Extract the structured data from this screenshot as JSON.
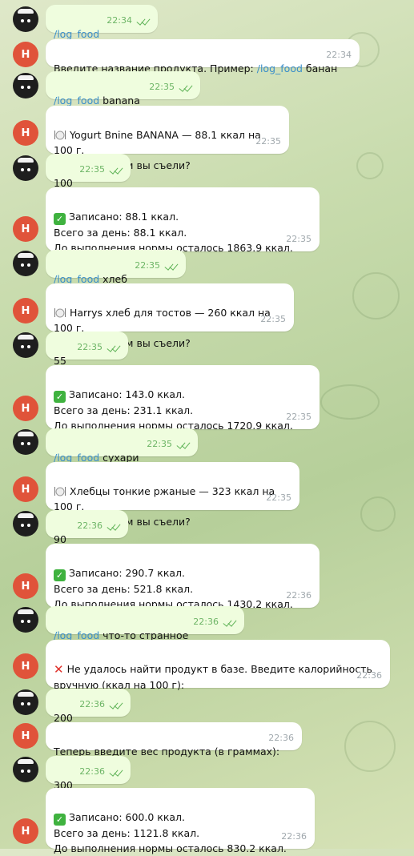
{
  "chat": {
    "user_avatar_icon": "user-avatar",
    "bot_avatar_letter": "Н",
    "messages": [
      {
        "from": "user",
        "cmd": "/log_food",
        "text": "",
        "time": "22:34"
      },
      {
        "from": "bot",
        "text": "Введите название продукта. Пример: ",
        "cmd": "/log_food",
        "text_after": " банан",
        "time": "22:34"
      },
      {
        "from": "user",
        "cmd": "/log_food",
        "text": " banana",
        "time": "22:35"
      },
      {
        "from": "bot",
        "icon": "plate-icon",
        "text": "Yogurt Bnine BANANA — 88.1 ккал на 100 г.\nСколько грамм вы съели?",
        "time": "22:35"
      },
      {
        "from": "user",
        "text": "100",
        "time": "22:35"
      },
      {
        "from": "bot",
        "icon": "check-mark-icon",
        "text": "Записано: 88.1 ккал.\nВсего за день: 88.1 ккал.\nДо выполнения нормы осталось 1863.9 ккал.",
        "time": "22:35"
      },
      {
        "from": "user",
        "cmd": "/log_food",
        "text": " хлеб",
        "time": "22:35"
      },
      {
        "from": "bot",
        "icon": "plate-icon",
        "text": "Harrys хлеб для тостов — 260 ккал на 100 г.\nСколько грамм вы съели?",
        "time": "22:35"
      },
      {
        "from": "user",
        "text": "55",
        "time": "22:35"
      },
      {
        "from": "bot",
        "icon": "check-mark-icon",
        "text": "Записано: 143.0 ккал.\nВсего за день: 231.1 ккал.\nДо выполнения нормы осталось 1720.9 ккал.",
        "time": "22:35"
      },
      {
        "from": "user",
        "cmd": "/log_food",
        "text": " сухари",
        "time": "22:35"
      },
      {
        "from": "bot",
        "icon": "plate-icon",
        "text": "Хлебцы тонкие ржаные — 323 ккал на 100 г.\nСколько грамм вы съели?",
        "time": "22:35"
      },
      {
        "from": "user",
        "text": "90",
        "time": "22:36"
      },
      {
        "from": "bot",
        "icon": "check-mark-icon",
        "text": "Записано: 290.7 ккал.\nВсего за день: 521.8 ккал.\nДо выполнения нормы осталось 1430.2 ккал.",
        "time": "22:36"
      },
      {
        "from": "user",
        "cmd": "/log_food",
        "text": " что-то странное",
        "time": "22:36"
      },
      {
        "from": "bot",
        "icon": "cross-mark-icon",
        "text": "Не удалось найти продукт в базе. Введите калорийность\nвручную (ккал на 100 г):",
        "time": "22:36"
      },
      {
        "from": "user",
        "text": "200",
        "time": "22:36"
      },
      {
        "from": "bot",
        "text": "Теперь введите вес продукта (в граммах):",
        "time": "22:36"
      },
      {
        "from": "user",
        "text": "300",
        "time": "22:36"
      },
      {
        "from": "bot",
        "icon": "check-mark-icon",
        "text": "Записано: 600.0 ккал.\nВсего за день: 1121.8 ккал.\nДо выполнения нормы осталось 830.2 ккал.",
        "time": "22:36"
      }
    ]
  }
}
